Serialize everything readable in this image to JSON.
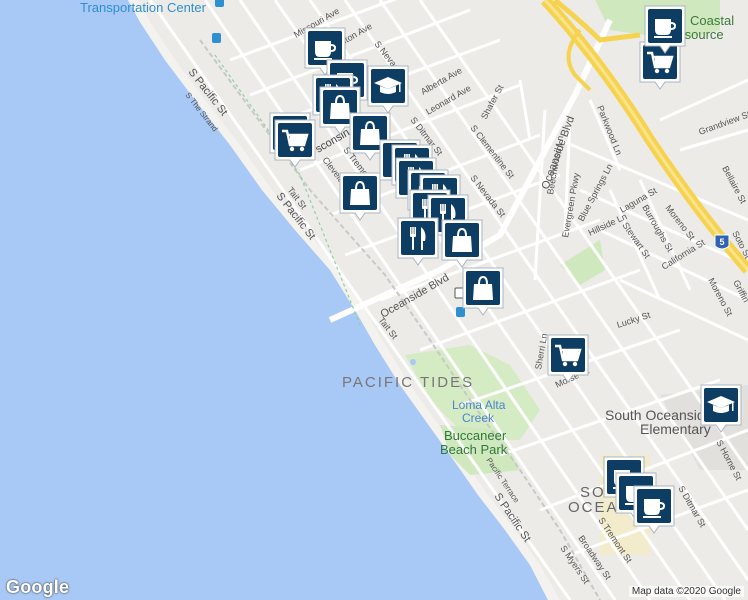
{
  "map": {
    "attribution": "Map data ©2020 Google",
    "logo": "Google",
    "ocean_color": "#a8c8f5",
    "freeway_color": "#f5d34e",
    "park_color": "#c8e6b5",
    "pin_color": "#0e3d63",
    "labels": {
      "transportation_center": "Transportation Center",
      "coastal_resource_1": "Coastal",
      "coastal_resource_2": "Fam   source",
      "pacific_tides": "PACIFIC TIDES",
      "loma_alta_1": "Loma Alta",
      "loma_alta_2": "Creek",
      "buccaneer_1": "Buccaneer",
      "buccaneer_2": "Beach Park",
      "school_1": "South Oceansid",
      "school_2": "Elementary",
      "so_oceanside_1": "SO",
      "so_oceanside_2": "OCEAN",
      "freeway_shield": "5"
    },
    "streets": {
      "s_pacific_st_1": "S Pacific St",
      "s_pacific_st_2": "S Pacific St",
      "s_the_strand": "S The Strand",
      "oceanside_blvd_1": "Oceanside Blvd",
      "oceanside_blvd_2": "Oceanside Blvd",
      "missouri_ave": "Missouri Ave",
      "alberta_ave": "Alberta Ave",
      "leonard_ave": "Leonard Ave",
      "s_ditmar_st": "S Ditmar St",
      "s_clementine_st": "S Clementine St",
      "s_nevada_st": "S Nevada St",
      "shafer_st": "Shafer St",
      "parkwood_ln": "Parkwood Ln",
      "beechwood_ln": "Beechwood Ln",
      "evergreen_pkwy": "Evergreen Pkwy",
      "blue_springs_ln": "Blue Springs Ln",
      "hillside_ln": "Hillside Ln",
      "laguna_st": "Laguna St",
      "stewart_st": "Stewart St",
      "burroughs_st": "Burroughs St",
      "moreno_st_1": "Moreno St",
      "moreno_st_2": "Moreno St",
      "california_st": "California St",
      "grandview_st": "Grandview St",
      "bellaire_st": "Bellaire St",
      "lucky_st": "Lucky St",
      "morse_st": "Morse St",
      "sherri_ln": "Sherri Ln",
      "tait_st_1": "Tait St",
      "tait_st_2": "Tait St",
      "pacific_terrace": "Pacific Terrace",
      "s_myers_st": "S Myers St",
      "broadway_st": "Broadway St",
      "s_tremont_st": "S Tremont St",
      "s_ditmar_st_2": "S Ditmar St",
      "s_horne_st": "S Horne St",
      "cleveland": "Clevelan",
      "wisconsin": "sconsin",
      "s_tremont_north": "S Tremont",
      "ston_ave": "ston Ave",
      "s_nevada_north": "S Nevad",
      "griffin": "Griffin",
      "soto_st": "Soto St"
    }
  }
}
